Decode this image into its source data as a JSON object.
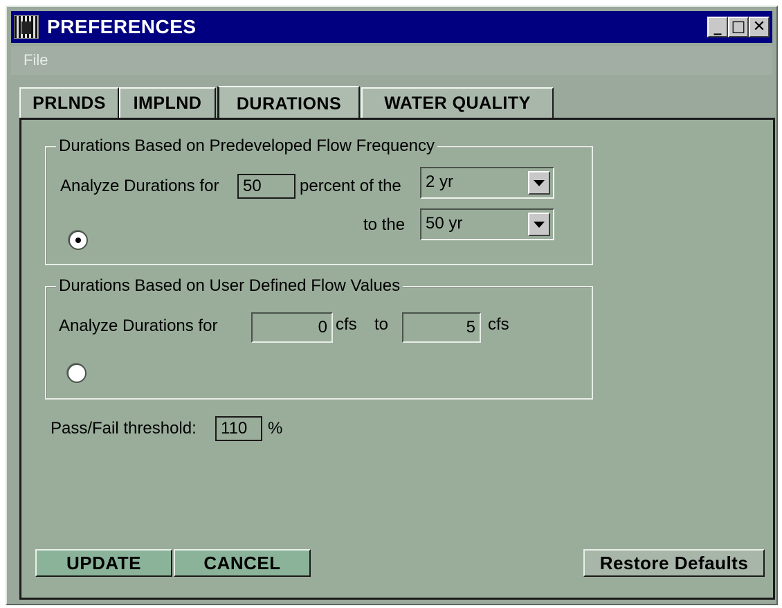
{
  "window": {
    "title": "PREFERENCES",
    "controls": {
      "minimize": "_",
      "maximize": "□",
      "close": "✕"
    }
  },
  "menu": {
    "file": "File"
  },
  "tabs": [
    {
      "label": "PRLNDS",
      "active": false
    },
    {
      "label": "IMPLND",
      "active": false
    },
    {
      "label": "DURATIONS",
      "active": true
    },
    {
      "label": "WATER QUALITY",
      "active": false
    }
  ],
  "group1": {
    "legend": "Durations Based on Predeveloped Flow Frequency",
    "analyze_label": "Analyze Durations for",
    "percent_value": "50",
    "percent_label": "percent of the",
    "from_select": "2 yr",
    "to_label": "to the",
    "to_select": "50 yr",
    "radio_selected": true
  },
  "group2": {
    "legend": "Durations Based on User Defined Flow Values",
    "analyze_label": "Analyze Durations for",
    "from_value": "0",
    "unit1": "cfs",
    "to_label": "to",
    "to_value": "5",
    "unit2": "cfs",
    "radio_selected": false
  },
  "threshold": {
    "label": "Pass/Fail threshold:",
    "value": "110",
    "unit": "%"
  },
  "buttons": {
    "update": "UPDATE",
    "cancel": "CANCEL",
    "restore": "Restore Defaults"
  }
}
